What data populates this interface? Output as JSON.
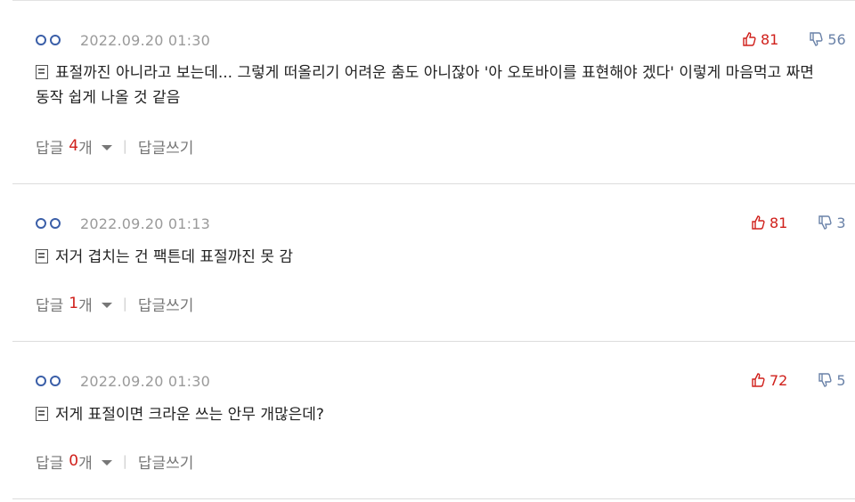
{
  "comments": [
    {
      "date": "2022.09.20 01:30",
      "likes": "81",
      "dislikes": "56",
      "text_line1": "표절까진 아니라고 보는데... 그렇게 떠올리기 어려운 춤도 아니잖아 '아 오토바이를 표현해야 겠다' 이렇게 마음먹고 짜면",
      "text_line2": "동작 쉽게 나올 것 같음",
      "reply_prefix": "답글",
      "reply_count": "4",
      "reply_suffix": "개",
      "write_reply": "답글쓰기"
    },
    {
      "date": "2022.09.20 01:13",
      "likes": "81",
      "dislikes": "3",
      "text_line1": "저거 겹치는 건 팩튼데 표절까진 못 감",
      "reply_prefix": "답글",
      "reply_count": "1",
      "reply_suffix": "개",
      "write_reply": "답글쓰기"
    },
    {
      "date": "2022.09.20 01:30",
      "likes": "72",
      "dislikes": "5",
      "text_line1": "저게 표절이면 크라운 쓰는 안무 개많은데?",
      "reply_prefix": "답글",
      "reply_count": "0",
      "reply_suffix": "개",
      "write_reply": "답글쓰기"
    }
  ],
  "icons": {
    "user": "user-avatar-dots-icon",
    "like": "thumbs-up-icon",
    "dislike": "thumbs-down-icon",
    "document": "document-icon",
    "toggle": "caret-down-icon"
  },
  "colors": {
    "like": "#d0201b",
    "dislike": "#6a82a8",
    "reply_count": "#d0201b",
    "date": "#9a9a9a"
  }
}
